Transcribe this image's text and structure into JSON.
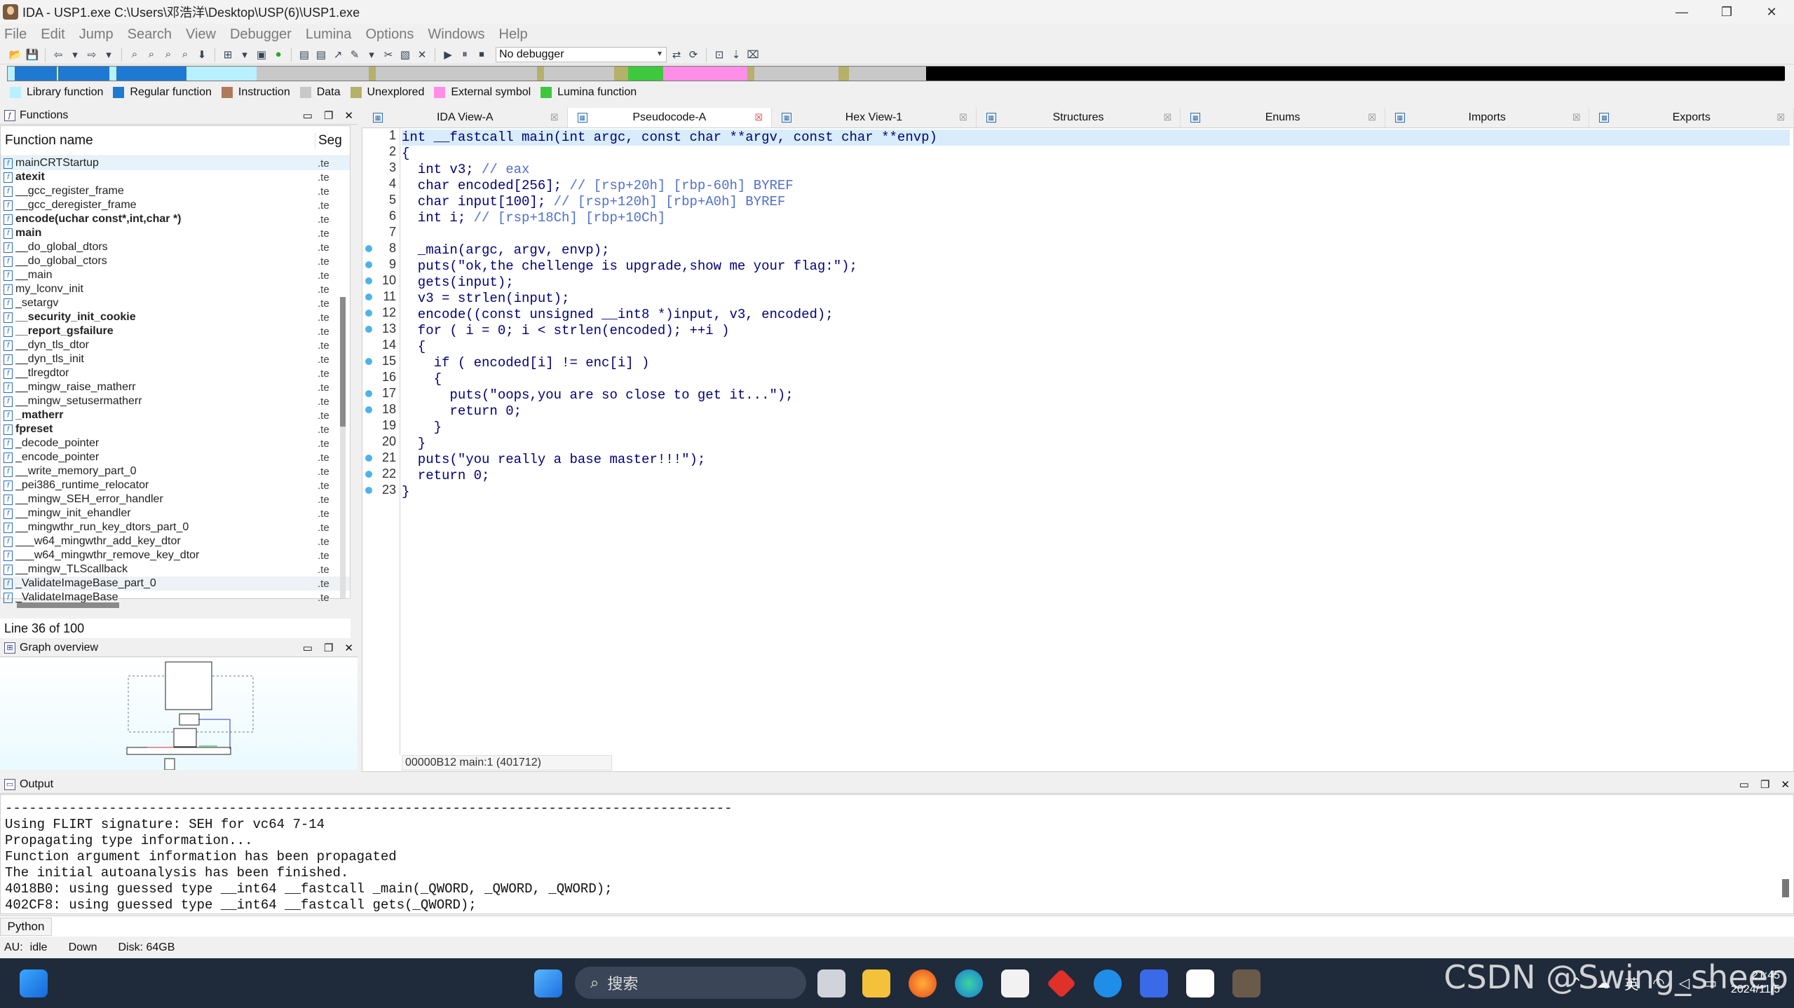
{
  "window": {
    "title": "IDA - USP1.exe C:\\Users\\邓浩洋\\Desktop\\USP(6)\\USP1.exe",
    "minimize": "—",
    "maximize": "❐",
    "close": "✕"
  },
  "menu": [
    "File",
    "Edit",
    "Jump",
    "Search",
    "View",
    "Debugger",
    "Lumina",
    "Options",
    "Windows",
    "Help"
  ],
  "toolbar": {
    "debugger": "No debugger"
  },
  "legend": [
    {
      "label": "Library function",
      "color": "#b8f0ff"
    },
    {
      "label": "Regular function",
      "color": "#1f78d1"
    },
    {
      "label": "Instruction",
      "color": "#b07a5a"
    },
    {
      "label": "Data",
      "color": "#c8c8c8"
    },
    {
      "label": "Unexplored",
      "color": "#b5b06a"
    },
    {
      "label": "External symbol",
      "color": "#ff8ee8"
    },
    {
      "label": "Lumina function",
      "color": "#3ec83e"
    }
  ],
  "functions": {
    "title": "Functions",
    "col_name": "Function name",
    "col_seg": "Seg",
    "rows": [
      {
        "name": "mainCRTStartup",
        "seg": ".te",
        "bold": false
      },
      {
        "name": "atexit",
        "seg": ".te",
        "bold": true
      },
      {
        "name": "__gcc_register_frame",
        "seg": ".te",
        "bold": false
      },
      {
        "name": "__gcc_deregister_frame",
        "seg": ".te",
        "bold": false
      },
      {
        "name": "encode(uchar const*,int,char *)",
        "seg": ".te",
        "bold": true
      },
      {
        "name": "main",
        "seg": ".te",
        "bold": true
      },
      {
        "name": "__do_global_dtors",
        "seg": ".te",
        "bold": false
      },
      {
        "name": "__do_global_ctors",
        "seg": ".te",
        "bold": false
      },
      {
        "name": "__main",
        "seg": ".te",
        "bold": false
      },
      {
        "name": "my_lconv_init",
        "seg": ".te",
        "bold": false
      },
      {
        "name": "_setargv",
        "seg": ".te",
        "bold": false
      },
      {
        "name": "__security_init_cookie",
        "seg": ".te",
        "bold": true
      },
      {
        "name": "__report_gsfailure",
        "seg": ".te",
        "bold": true
      },
      {
        "name": "__dyn_tls_dtor",
        "seg": ".te",
        "bold": false
      },
      {
        "name": "__dyn_tls_init",
        "seg": ".te",
        "bold": false
      },
      {
        "name": "__tlregdtor",
        "seg": ".te",
        "bold": false
      },
      {
        "name": "__mingw_raise_matherr",
        "seg": ".te",
        "bold": false
      },
      {
        "name": "__mingw_setusermatherr",
        "seg": ".te",
        "bold": false
      },
      {
        "name": "_matherr",
        "seg": ".te",
        "bold": true
      },
      {
        "name": "fpreset",
        "seg": ".te",
        "bold": true
      },
      {
        "name": "_decode_pointer",
        "seg": ".te",
        "bold": false
      },
      {
        "name": "_encode_pointer",
        "seg": ".te",
        "bold": false
      },
      {
        "name": "__write_memory_part_0",
        "seg": ".te",
        "bold": false
      },
      {
        "name": "_pei386_runtime_relocator",
        "seg": ".te",
        "bold": false
      },
      {
        "name": "__mingw_SEH_error_handler",
        "seg": ".te",
        "bold": false
      },
      {
        "name": "__mingw_init_ehandler",
        "seg": ".te",
        "bold": false
      },
      {
        "name": "__mingwthr_run_key_dtors_part_0",
        "seg": ".te",
        "bold": false
      },
      {
        "name": "___w64_mingwthr_add_key_dtor",
        "seg": ".te",
        "bold": false
      },
      {
        "name": "___w64_mingwthr_remove_key_dtor",
        "seg": ".te",
        "bold": false
      },
      {
        "name": "__mingw_TLScallback",
        "seg": ".te",
        "bold": false
      },
      {
        "name": "_ValidateImageBase_part_0",
        "seg": ".te",
        "bold": false
      },
      {
        "name": "_ValidateImageBase",
        "seg": ".te",
        "bold": false
      }
    ],
    "status": "Line 36 of 100"
  },
  "graph_overview": {
    "title": "Graph overview"
  },
  "tabs": [
    {
      "label": "IDA View-A",
      "icon": "graph-icon"
    },
    {
      "label": "Pseudocode-A",
      "icon": "pseudocode-icon",
      "active": true
    },
    {
      "label": "Hex View-1",
      "icon": "hex-icon"
    },
    {
      "label": "Structures",
      "icon": "struct-icon"
    },
    {
      "label": "Enums",
      "icon": "enum-icon"
    },
    {
      "label": "Imports",
      "icon": "imports-icon"
    },
    {
      "label": "Exports",
      "icon": "exports-icon"
    }
  ],
  "code": {
    "lines": [
      {
        "n": "1",
        "dot": false,
        "t": "int __fastcall main(int argc, const char **argv, const char **envp)"
      },
      {
        "n": "2",
        "dot": false,
        "t": "{"
      },
      {
        "n": "3",
        "dot": false,
        "t": "  int v3; // eax"
      },
      {
        "n": "4",
        "dot": false,
        "t": "  char encoded[256]; // [rsp+20h] [rbp-60h] BYREF"
      },
      {
        "n": "5",
        "dot": false,
        "t": "  char input[100]; // [rsp+120h] [rbp+A0h] BYREF"
      },
      {
        "n": "6",
        "dot": false,
        "t": "  int i; // [rsp+18Ch] [rbp+10Ch]"
      },
      {
        "n": "7",
        "dot": false,
        "t": ""
      },
      {
        "n": "8",
        "dot": true,
        "t": "  _main(argc, argv, envp);"
      },
      {
        "n": "9",
        "dot": true,
        "t": "  puts(\"ok,the chellenge is upgrade,show me your flag:\");"
      },
      {
        "n": "10",
        "dot": true,
        "t": "  gets(input);"
      },
      {
        "n": "11",
        "dot": true,
        "t": "  v3 = strlen(input);"
      },
      {
        "n": "12",
        "dot": true,
        "t": "  encode((const unsigned __int8 *)input, v3, encoded);"
      },
      {
        "n": "13",
        "dot": true,
        "t": "  for ( i = 0; i < strlen(encoded); ++i )"
      },
      {
        "n": "14",
        "dot": false,
        "t": "  {"
      },
      {
        "n": "15",
        "dot": true,
        "t": "    if ( encoded[i] != enc[i] )"
      },
      {
        "n": "16",
        "dot": false,
        "t": "    {"
      },
      {
        "n": "17",
        "dot": true,
        "t": "      puts(\"oops,you are so close to get it...\");"
      },
      {
        "n": "18",
        "dot": true,
        "t": "      return 0;"
      },
      {
        "n": "19",
        "dot": false,
        "t": "    }"
      },
      {
        "n": "20",
        "dot": false,
        "t": "  }"
      },
      {
        "n": "21",
        "dot": true,
        "t": "  puts(\"you really a base master!!!\");"
      },
      {
        "n": "22",
        "dot": true,
        "t": "  return 0;"
      },
      {
        "n": "23",
        "dot": true,
        "t": "}"
      }
    ],
    "address": "00000B12 main:1 (401712)"
  },
  "output": {
    "title": "Output",
    "lines": [
      "-------------------------------------------------------------------------------------------",
      "Using FLIRT signature: SEH for vc64 7-14",
      "Propagating type information...",
      "Function argument information has been propagated",
      "The initial autoanalysis has been finished.",
      "4018B0: using guessed type __int64 __fastcall _main(_QWORD, _QWORD, _QWORD);",
      "402CF8: using guessed type __int64 __fastcall gets(_QWORD);"
    ]
  },
  "python_button": "Python",
  "status": {
    "au": "AU:",
    "state": "idle",
    "dir": "Down",
    "disk": "Disk: 64GB"
  },
  "taskbar": {
    "search": "搜索",
    "lang": "英",
    "time": "21:45",
    "date": "2024/11/5"
  },
  "watermark": "CSDN @Swing_sheep"
}
